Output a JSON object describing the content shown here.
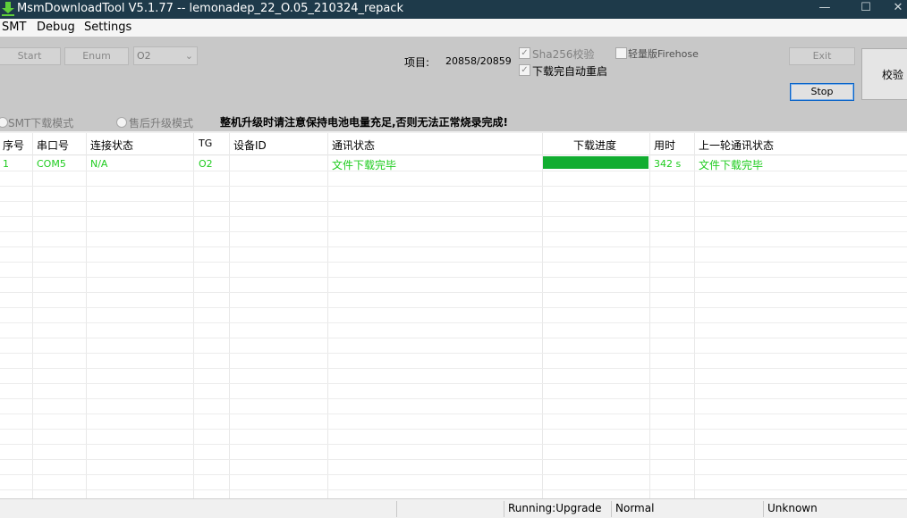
{
  "window": {
    "title": "MsmDownloadTool V5.1.77 -- lemonadep_22_O.05_210324_repack",
    "minimize": "—",
    "maximize": "☐",
    "close": "✕"
  },
  "menu": [
    "SMT",
    "Debug",
    "Settings"
  ],
  "toolbar": {
    "start": "Start",
    "enum": "Enum",
    "select_value": "O2",
    "project_label": "项目:",
    "project_value": "20858/20859",
    "sha256_label": "Sha256校验",
    "auto_reboot_label": "下载完自动重启",
    "lite_firehose_label": "轻量版Firehose",
    "exit": "Exit",
    "stop": "Stop",
    "verify": "校验"
  },
  "modes": {
    "smt": "SMT下载模式",
    "after_sales": "售后升级模式",
    "warning": "整机升级时请注意保持电池电量充足,否则无法正常烧录完成!"
  },
  "table": {
    "headers": [
      "序号",
      "串口号",
      "连接状态",
      "TG",
      "设备ID",
      "通讯状态",
      "下载进度",
      "用时",
      "上一轮通讯状态"
    ],
    "rows": [
      {
        "index": "1",
        "port": "COM5",
        "conn": "N/A",
        "tg": "O2",
        "device_id": "",
        "comm_status": "文件下载完毕",
        "progress_fraction": 1.0,
        "time": "342 s",
        "last_status": "文件下载完毕"
      }
    ]
  },
  "status": {
    "running": "Running:Upgrade",
    "mode": "Normal",
    "unknown": "Unknown"
  },
  "colors": {
    "titlebar": "#1e3a4a",
    "success_text": "#1fcc1f",
    "progress": "#11ad30"
  }
}
